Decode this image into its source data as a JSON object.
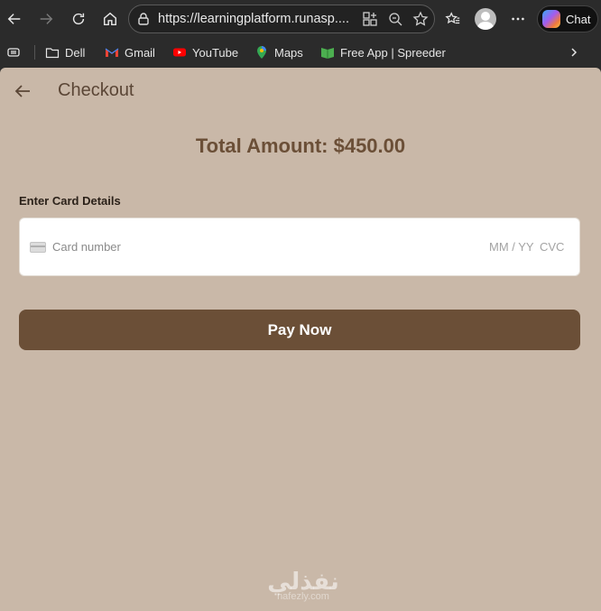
{
  "browser": {
    "url": "https://learningplatform.runasp....",
    "chat_label": "Chat"
  },
  "bookmarks": [
    {
      "label": "Dell",
      "icon": "folder-icon"
    },
    {
      "label": "Gmail",
      "icon": "gmail-icon"
    },
    {
      "label": "YouTube",
      "icon": "youtube-icon"
    },
    {
      "label": "Maps",
      "icon": "maps-icon"
    },
    {
      "label": "Free App | Spreeder",
      "icon": "spreeder-icon"
    }
  ],
  "page": {
    "title": "Checkout",
    "total": "Total Amount: $450.00",
    "card_section_label": "Enter Card Details",
    "card_number_placeholder": "Card number",
    "expiry_placeholder": "MM / YY",
    "cvc_placeholder": "CVC",
    "pay_button": "Pay Now"
  },
  "watermark": {
    "arabic": "نفذلي",
    "latin": "nafezly.com"
  },
  "colors": {
    "page_background": "#c9b8a8",
    "accent_brown": "#6b4f37",
    "browser_chrome": "#2b2b2b"
  }
}
